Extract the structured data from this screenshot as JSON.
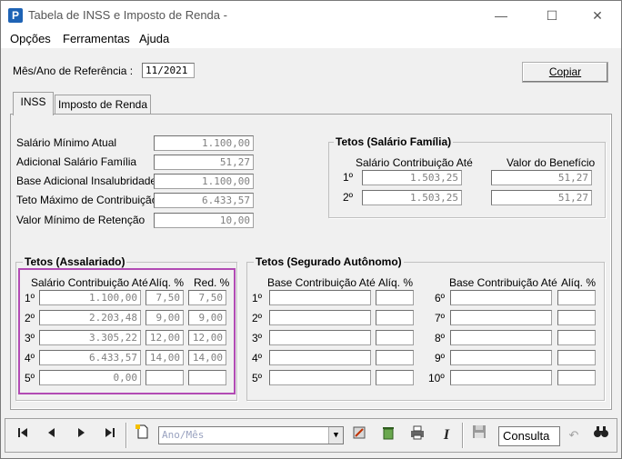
{
  "window": {
    "title": "Tabela de INSS e Imposto de Renda -",
    "app_icon_glyph": "P",
    "minimize": "—",
    "maximize": "☐",
    "close": "✕"
  },
  "menu": [
    "Opções",
    "Ferramentas",
    "Ajuda"
  ],
  "header": {
    "ref_label": "Mês/Ano de Referência :",
    "ref_value": "11/2021",
    "copy_button": "Copiar"
  },
  "tabs": [
    {
      "label": "INSS",
      "active": true
    },
    {
      "label": "Imposto de Renda",
      "active": false
    }
  ],
  "inss": {
    "rows": [
      {
        "label": "Salário Mínimo Atual",
        "value": "1.100,00"
      },
      {
        "label": "Adicional Salário Família",
        "value": "51,27"
      },
      {
        "label": "Base Adicional Insalubridade",
        "value": "1.100,00"
      },
      {
        "label": "Teto Máximo de Contribuição",
        "value": "6.433,57"
      },
      {
        "label": "Valor Mínimo de Retenção",
        "value": "10,00"
      }
    ]
  },
  "salario_familia": {
    "title": "Tetos (Salário Família)",
    "col1": "Salário Contribuição Até",
    "col2": "Valor do Benefício",
    "rows": [
      {
        "ord": "1º",
        "ate": "1.503,25",
        "beneficio": "51,27"
      },
      {
        "ord": "2º",
        "ate": "1.503,25",
        "beneficio": "51,27"
      }
    ]
  },
  "assalariado": {
    "title": "Tetos (Assalariado)",
    "col1": "Salário Contribuição Até",
    "col2": "Alíq. %",
    "col3": "Red. %",
    "rows": [
      {
        "ord": "1º",
        "ate": "1.100,00",
        "aliq": "7,50",
        "red": "7,50"
      },
      {
        "ord": "2º",
        "ate": "2.203,48",
        "aliq": "9,00",
        "red": "9,00"
      },
      {
        "ord": "3º",
        "ate": "3.305,22",
        "aliq": "12,00",
        "red": "12,00"
      },
      {
        "ord": "4º",
        "ate": "6.433,57",
        "aliq": "14,00",
        "red": "14,00"
      },
      {
        "ord": "5º",
        "ate": "0,00",
        "aliq": "",
        "red": ""
      }
    ]
  },
  "autonomo": {
    "title": "Tetos (Segurado Autônomo)",
    "col1": "Base Contribuição Até",
    "col2": "Alíq. %",
    "left_ords": [
      "1º",
      "2º",
      "3º",
      "4º",
      "5º"
    ],
    "right_ords": [
      "6º",
      "7º",
      "8º",
      "9º",
      "10º"
    ]
  },
  "toolbar": {
    "combo_placeholder": "Ano/Mês",
    "mode": "Consulta",
    "icons": [
      "first-icon",
      "prev-icon",
      "next-icon",
      "last-icon",
      "new-icon",
      "edit-icon",
      "delete-icon",
      "print-icon",
      "italic-icon",
      "save-icon",
      "undo-icon",
      "search-icon"
    ]
  }
}
